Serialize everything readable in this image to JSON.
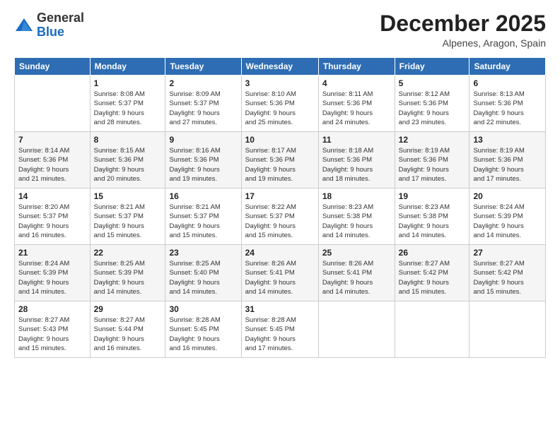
{
  "logo": {
    "general": "General",
    "blue": "Blue"
  },
  "header": {
    "month": "December 2025",
    "location": "Alpenes, Aragon, Spain"
  },
  "weekdays": [
    "Sunday",
    "Monday",
    "Tuesday",
    "Wednesday",
    "Thursday",
    "Friday",
    "Saturday"
  ],
  "weeks": [
    [
      {
        "day": "",
        "info": ""
      },
      {
        "day": "1",
        "info": "Sunrise: 8:08 AM\nSunset: 5:37 PM\nDaylight: 9 hours\nand 28 minutes."
      },
      {
        "day": "2",
        "info": "Sunrise: 8:09 AM\nSunset: 5:37 PM\nDaylight: 9 hours\nand 27 minutes."
      },
      {
        "day": "3",
        "info": "Sunrise: 8:10 AM\nSunset: 5:36 PM\nDaylight: 9 hours\nand 25 minutes."
      },
      {
        "day": "4",
        "info": "Sunrise: 8:11 AM\nSunset: 5:36 PM\nDaylight: 9 hours\nand 24 minutes."
      },
      {
        "day": "5",
        "info": "Sunrise: 8:12 AM\nSunset: 5:36 PM\nDaylight: 9 hours\nand 23 minutes."
      },
      {
        "day": "6",
        "info": "Sunrise: 8:13 AM\nSunset: 5:36 PM\nDaylight: 9 hours\nand 22 minutes."
      }
    ],
    [
      {
        "day": "7",
        "info": "Sunrise: 8:14 AM\nSunset: 5:36 PM\nDaylight: 9 hours\nand 21 minutes."
      },
      {
        "day": "8",
        "info": "Sunrise: 8:15 AM\nSunset: 5:36 PM\nDaylight: 9 hours\nand 20 minutes."
      },
      {
        "day": "9",
        "info": "Sunrise: 8:16 AM\nSunset: 5:36 PM\nDaylight: 9 hours\nand 19 minutes."
      },
      {
        "day": "10",
        "info": "Sunrise: 8:17 AM\nSunset: 5:36 PM\nDaylight: 9 hours\nand 19 minutes."
      },
      {
        "day": "11",
        "info": "Sunrise: 8:18 AM\nSunset: 5:36 PM\nDaylight: 9 hours\nand 18 minutes."
      },
      {
        "day": "12",
        "info": "Sunrise: 8:19 AM\nSunset: 5:36 PM\nDaylight: 9 hours\nand 17 minutes."
      },
      {
        "day": "13",
        "info": "Sunrise: 8:19 AM\nSunset: 5:36 PM\nDaylight: 9 hours\nand 17 minutes."
      }
    ],
    [
      {
        "day": "14",
        "info": "Sunrise: 8:20 AM\nSunset: 5:37 PM\nDaylight: 9 hours\nand 16 minutes."
      },
      {
        "day": "15",
        "info": "Sunrise: 8:21 AM\nSunset: 5:37 PM\nDaylight: 9 hours\nand 15 minutes."
      },
      {
        "day": "16",
        "info": "Sunrise: 8:21 AM\nSunset: 5:37 PM\nDaylight: 9 hours\nand 15 minutes."
      },
      {
        "day": "17",
        "info": "Sunrise: 8:22 AM\nSunset: 5:37 PM\nDaylight: 9 hours\nand 15 minutes."
      },
      {
        "day": "18",
        "info": "Sunrise: 8:23 AM\nSunset: 5:38 PM\nDaylight: 9 hours\nand 14 minutes."
      },
      {
        "day": "19",
        "info": "Sunrise: 8:23 AM\nSunset: 5:38 PM\nDaylight: 9 hours\nand 14 minutes."
      },
      {
        "day": "20",
        "info": "Sunrise: 8:24 AM\nSunset: 5:39 PM\nDaylight: 9 hours\nand 14 minutes."
      }
    ],
    [
      {
        "day": "21",
        "info": "Sunrise: 8:24 AM\nSunset: 5:39 PM\nDaylight: 9 hours\nand 14 minutes."
      },
      {
        "day": "22",
        "info": "Sunrise: 8:25 AM\nSunset: 5:39 PM\nDaylight: 9 hours\nand 14 minutes."
      },
      {
        "day": "23",
        "info": "Sunrise: 8:25 AM\nSunset: 5:40 PM\nDaylight: 9 hours\nand 14 minutes."
      },
      {
        "day": "24",
        "info": "Sunrise: 8:26 AM\nSunset: 5:41 PM\nDaylight: 9 hours\nand 14 minutes."
      },
      {
        "day": "25",
        "info": "Sunrise: 8:26 AM\nSunset: 5:41 PM\nDaylight: 9 hours\nand 14 minutes."
      },
      {
        "day": "26",
        "info": "Sunrise: 8:27 AM\nSunset: 5:42 PM\nDaylight: 9 hours\nand 15 minutes."
      },
      {
        "day": "27",
        "info": "Sunrise: 8:27 AM\nSunset: 5:42 PM\nDaylight: 9 hours\nand 15 minutes."
      }
    ],
    [
      {
        "day": "28",
        "info": "Sunrise: 8:27 AM\nSunset: 5:43 PM\nDaylight: 9 hours\nand 15 minutes."
      },
      {
        "day": "29",
        "info": "Sunrise: 8:27 AM\nSunset: 5:44 PM\nDaylight: 9 hours\nand 16 minutes."
      },
      {
        "day": "30",
        "info": "Sunrise: 8:28 AM\nSunset: 5:45 PM\nDaylight: 9 hours\nand 16 minutes."
      },
      {
        "day": "31",
        "info": "Sunrise: 8:28 AM\nSunset: 5:45 PM\nDaylight: 9 hours\nand 17 minutes."
      },
      {
        "day": "",
        "info": ""
      },
      {
        "day": "",
        "info": ""
      },
      {
        "day": "",
        "info": ""
      }
    ]
  ]
}
